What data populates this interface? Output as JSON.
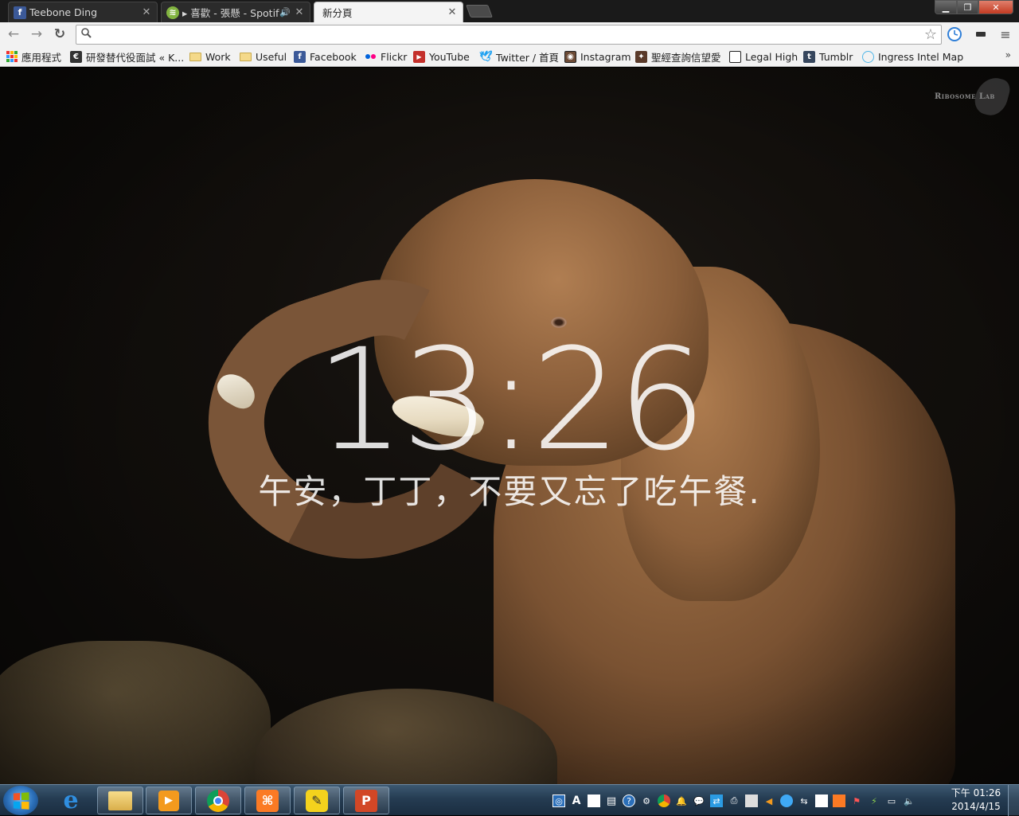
{
  "tabs": [
    {
      "title": "Teebone Ding",
      "icon": "facebook-icon"
    },
    {
      "title": "▸ 喜歡 - 張懸 - Spotify",
      "icon": "spotify-icon",
      "audio": "🔊"
    },
    {
      "title": "新分頁",
      "icon": "none",
      "active": true
    }
  ],
  "toolbar": {
    "back": "←",
    "forward": "→",
    "reload": "↻",
    "search_glyph": "🔍",
    "star": "☆",
    "address_value": "",
    "menu": "≡"
  },
  "bookmarks": {
    "items": [
      "應用程式",
      "研發替代役面試 « K...",
      "Work",
      "Useful",
      "Facebook",
      "Flickr",
      "YouTube",
      "Twitter / 首頁",
      "Instagram",
      "聖經查詢信望愛",
      "Legal High",
      "Tumblr",
      "Ingress Intel Map"
    ],
    "more": "»"
  },
  "page": {
    "logo_text": "Ribosome Lab",
    "time": "13:26",
    "greeting": "午安，丁丁，不要又忘了吃午餐."
  },
  "taskbar": {
    "apps": [
      "ie-icon",
      "explorer-icon",
      "media-player-icon",
      "chrome-icon",
      "xampp-icon",
      "pencil-app-icon",
      "powerpoint-icon"
    ],
    "clock_period": "下午 01:26",
    "clock_date": "2014/4/15"
  },
  "colors": {
    "accent": "#4a6d8c",
    "taskbar": "#253c52",
    "chrome_bar": "#f2f2f2"
  }
}
